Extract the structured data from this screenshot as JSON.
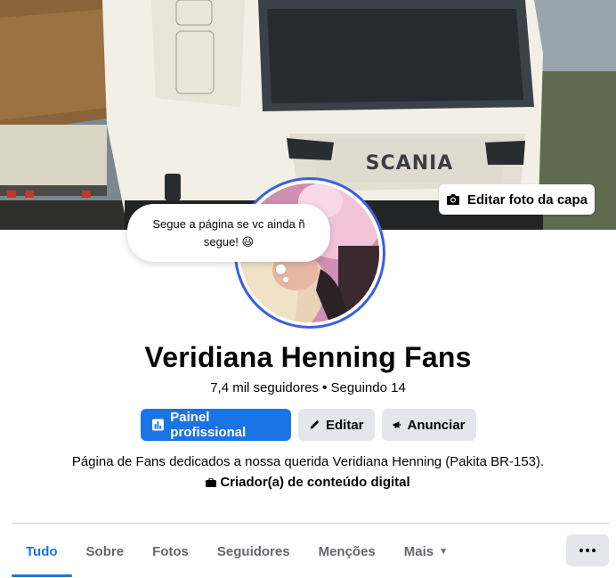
{
  "cover": {
    "edit_label": "Editar foto da capa",
    "truck_brand": "SCANIA"
  },
  "bubble": {
    "text": "Segue a página se vc ainda ñ segue! 😃"
  },
  "profile": {
    "name": "Veridiana Henning Fans",
    "followers": "7,4 mil seguidores",
    "following": "Seguindo 14",
    "separator": "•"
  },
  "actions": {
    "dashboard_label": "Painel profissional",
    "edit_label": "Editar",
    "advertise_label": "Anunciar"
  },
  "intro": {
    "bio": "Página de Fans dedicados a nossa querida Veridiana Henning (Pakita BR-153).",
    "category": "Criador(a) de conteúdo digital"
  },
  "tabs": [
    {
      "label": "Tudo",
      "active": true
    },
    {
      "label": "Sobre"
    },
    {
      "label": "Fotos"
    },
    {
      "label": "Seguidores"
    },
    {
      "label": "Menções"
    },
    {
      "label": "Mais"
    }
  ],
  "colors": {
    "accent": "#1b74e4",
    "avatar_ring": "#3b5fe0",
    "secondary_button": "#e4e6eb"
  }
}
